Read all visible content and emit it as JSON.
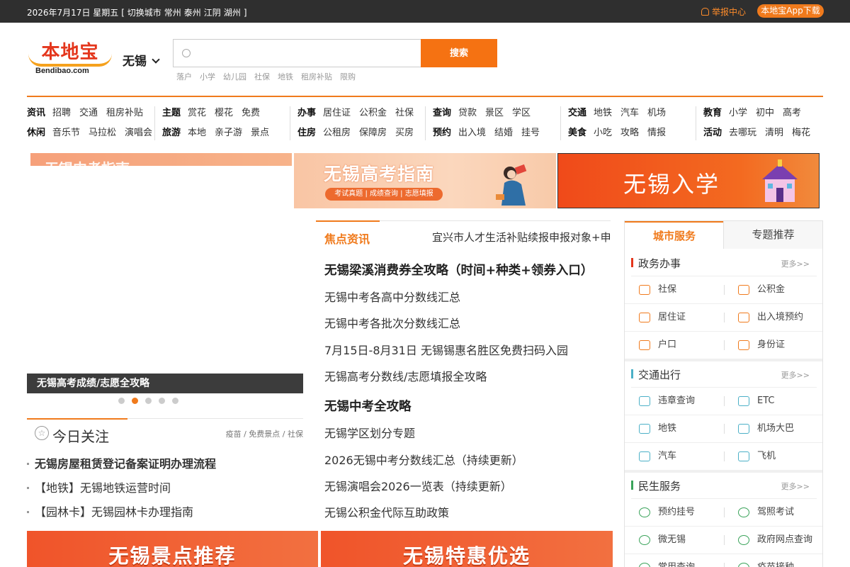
{
  "topbar": {
    "date": "2026年7月17日 星期五",
    "switch_prefix": "[ 切换城市",
    "cities": [
      "常州",
      "泰州",
      "江阴",
      "湖州"
    ],
    "switch_suffix": "]",
    "report": "举报中心",
    "app_download": "本地宝App下载"
  },
  "logo": {
    "cn": "本地宝",
    "en": "Bendibao.com"
  },
  "city": "无锡",
  "search": {
    "placeholder": "",
    "button": "搜索",
    "hotwords": [
      "落户",
      "小学",
      "幼儿园",
      "社保",
      "地铁",
      "租房补贴",
      "限购"
    ]
  },
  "nav": [
    {
      "rows": [
        {
          "head": "资讯",
          "items": [
            "招聘",
            "交通",
            "租房补贴"
          ]
        },
        {
          "head": "休闲",
          "items": [
            "音乐节",
            "马拉松",
            "演唱会"
          ]
        }
      ]
    },
    {
      "rows": [
        {
          "head": "主题",
          "items": [
            "赏花",
            "樱花",
            "免费"
          ]
        },
        {
          "head": "旅游",
          "items": [
            "本地",
            "亲子游",
            "景点"
          ]
        }
      ]
    },
    {
      "rows": [
        {
          "head": "办事",
          "items": [
            "居住证",
            "公积金",
            "社保"
          ]
        },
        {
          "head": "住房",
          "items": [
            "公租房",
            "保障房",
            "买房"
          ]
        }
      ]
    },
    {
      "rows": [
        {
          "head": "查询",
          "items": [
            "贷款",
            "景区",
            "学区"
          ]
        },
        {
          "head": "预约",
          "items": [
            "出入境",
            "结婚",
            "挂号"
          ]
        }
      ]
    },
    {
      "rows": [
        {
          "head": "交通",
          "items": [
            "地铁",
            "汽车",
            "机场"
          ]
        },
        {
          "head": "美食",
          "items": [
            "小吃",
            "攻略",
            "情报"
          ]
        }
      ]
    },
    {
      "rows": [
        {
          "head": "教育",
          "items": [
            "小学",
            "初中",
            "高考"
          ]
        },
        {
          "head": "活动",
          "items": [
            "去哪玩",
            "清明",
            "梅花"
          ]
        }
      ]
    }
  ],
  "banners": {
    "left_partial": "无锡中考指南",
    "gaokao_title": "无锡高考指南",
    "gaokao_pill": "考试真题 | 成绩查询 | 志愿填报",
    "ruxue_title": "无锡入学"
  },
  "slideshow": {
    "caption": "无锡高考成绩/志愿全攻略",
    "dot_count": 5,
    "active_dot": 1
  },
  "today": {
    "title": "今日关注",
    "links": "疫苗 / 免费景点 / 社保",
    "items": [
      "无锡房屋租赁登记备案证明办理流程",
      "【地铁】无锡地铁运营时间",
      "【园林卡】无锡园林卡办理指南"
    ]
  },
  "news": {
    "label": "焦点资讯",
    "ticker": "宜兴市人才生活补贴续报申报对象+申",
    "headline1": "无锡梁溪消费券全攻略（时间+种类+领券入口）",
    "group1": [
      "无锡中考各高中分数线汇总",
      "无锡中考各批次分数线汇总",
      "7月15日-8月31日 无锡锡惠名胜区免费扫码入园",
      "无锡高考分数线/志愿填报全攻略"
    ],
    "headline2": "无锡中考全攻略",
    "group2": [
      "无锡学区划分专题",
      "2026无锡中考分数线汇总（持续更新）",
      "无锡演唱会2026一览表（持续更新）",
      "无锡公积金代际互助政策"
    ]
  },
  "cards": {
    "left": "无锡景点推荐",
    "right": "无锡特惠优选"
  },
  "sidebar": {
    "tab_active": "城市服务",
    "tab_other": "专题推荐",
    "more": "更多>>",
    "sections": [
      {
        "name": "政务办事",
        "color": "#e4361c",
        "items": [
          "社保",
          "公积金",
          "居住证",
          "出入境预约",
          "户口",
          "身份证"
        ]
      },
      {
        "name": "交通出行",
        "color": "#4bb0c7",
        "items": [
          "违章查询",
          "ETC",
          "地铁",
          "机场大巴",
          "汽车",
          "飞机"
        ]
      },
      {
        "name": "民生服务",
        "color": "#3aa35a",
        "items": [
          "预约挂号",
          "驾照考试",
          "微无锡",
          "政府网点查询",
          "常用查询",
          "疫苗接种"
        ]
      }
    ]
  }
}
